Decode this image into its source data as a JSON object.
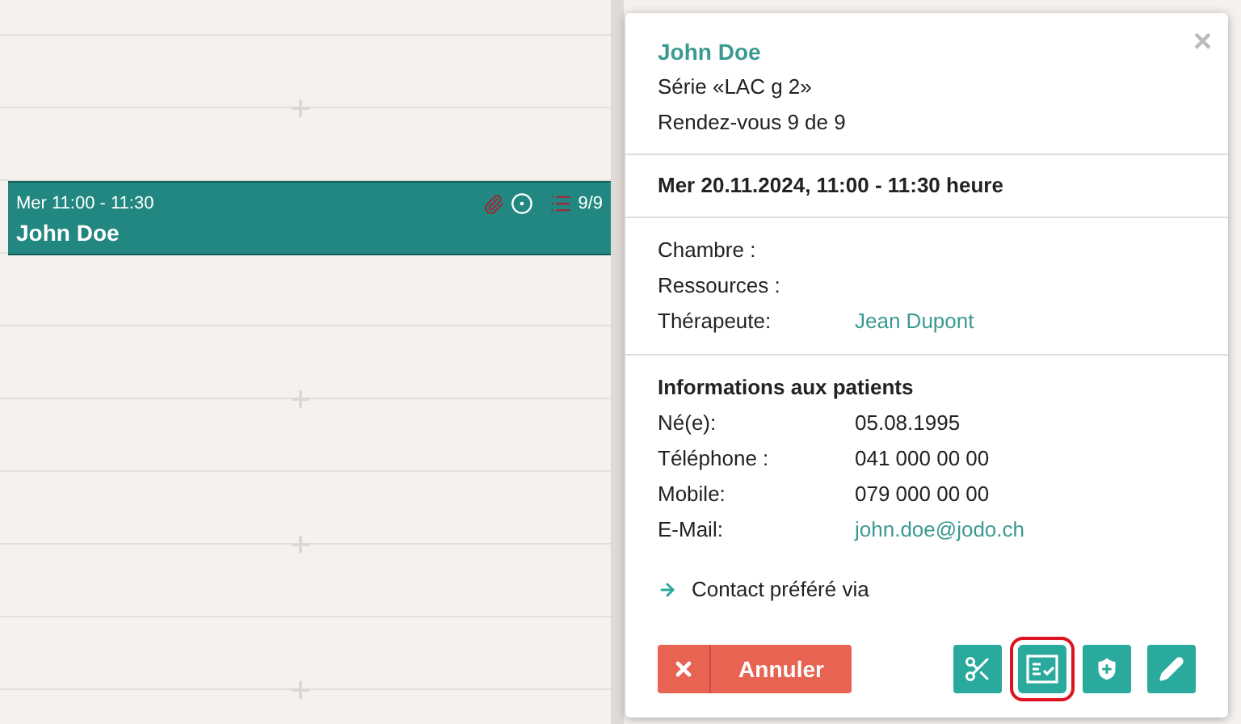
{
  "calendar": {
    "event": {
      "time": "Mer 11:00 - 11:30",
      "patient": "John Doe",
      "count": "9/9"
    }
  },
  "popup": {
    "close": "×",
    "patient": "John Doe",
    "series": "Série «LAC g 2»",
    "appointment": "Rendez-vous 9 de 9",
    "datetime": "Mer 20.11.2024, 11:00 - 11:30 heure",
    "details": [
      {
        "label": "Chambre :"
      },
      {
        "label": "Ressources :"
      },
      {
        "label": "Thérapeute:",
        "value": "Jean Dupont",
        "kind": "link"
      }
    ],
    "patient_info": {
      "title": "Informations aux patients",
      "rows": [
        {
          "label": "Né(e):",
          "value": "05.08.1995",
          "kind": "text"
        },
        {
          "label": "Téléphone :",
          "value": "041 000 00 00",
          "kind": "text"
        },
        {
          "label": "Mobile:",
          "value": "079 000 00 00",
          "kind": "text"
        },
        {
          "label": "E-Mail:",
          "value": "john.doe@jodo.ch",
          "kind": "link"
        }
      ]
    },
    "contact_preference": "Contact préféré via",
    "cancel": "Annuler",
    "actions": [
      {
        "kind": "cut",
        "focused": false
      },
      {
        "kind": "checklist",
        "focused": true
      },
      {
        "kind": "insurance",
        "focused": false
      },
      {
        "kind": "edit",
        "focused": false
      }
    ]
  }
}
